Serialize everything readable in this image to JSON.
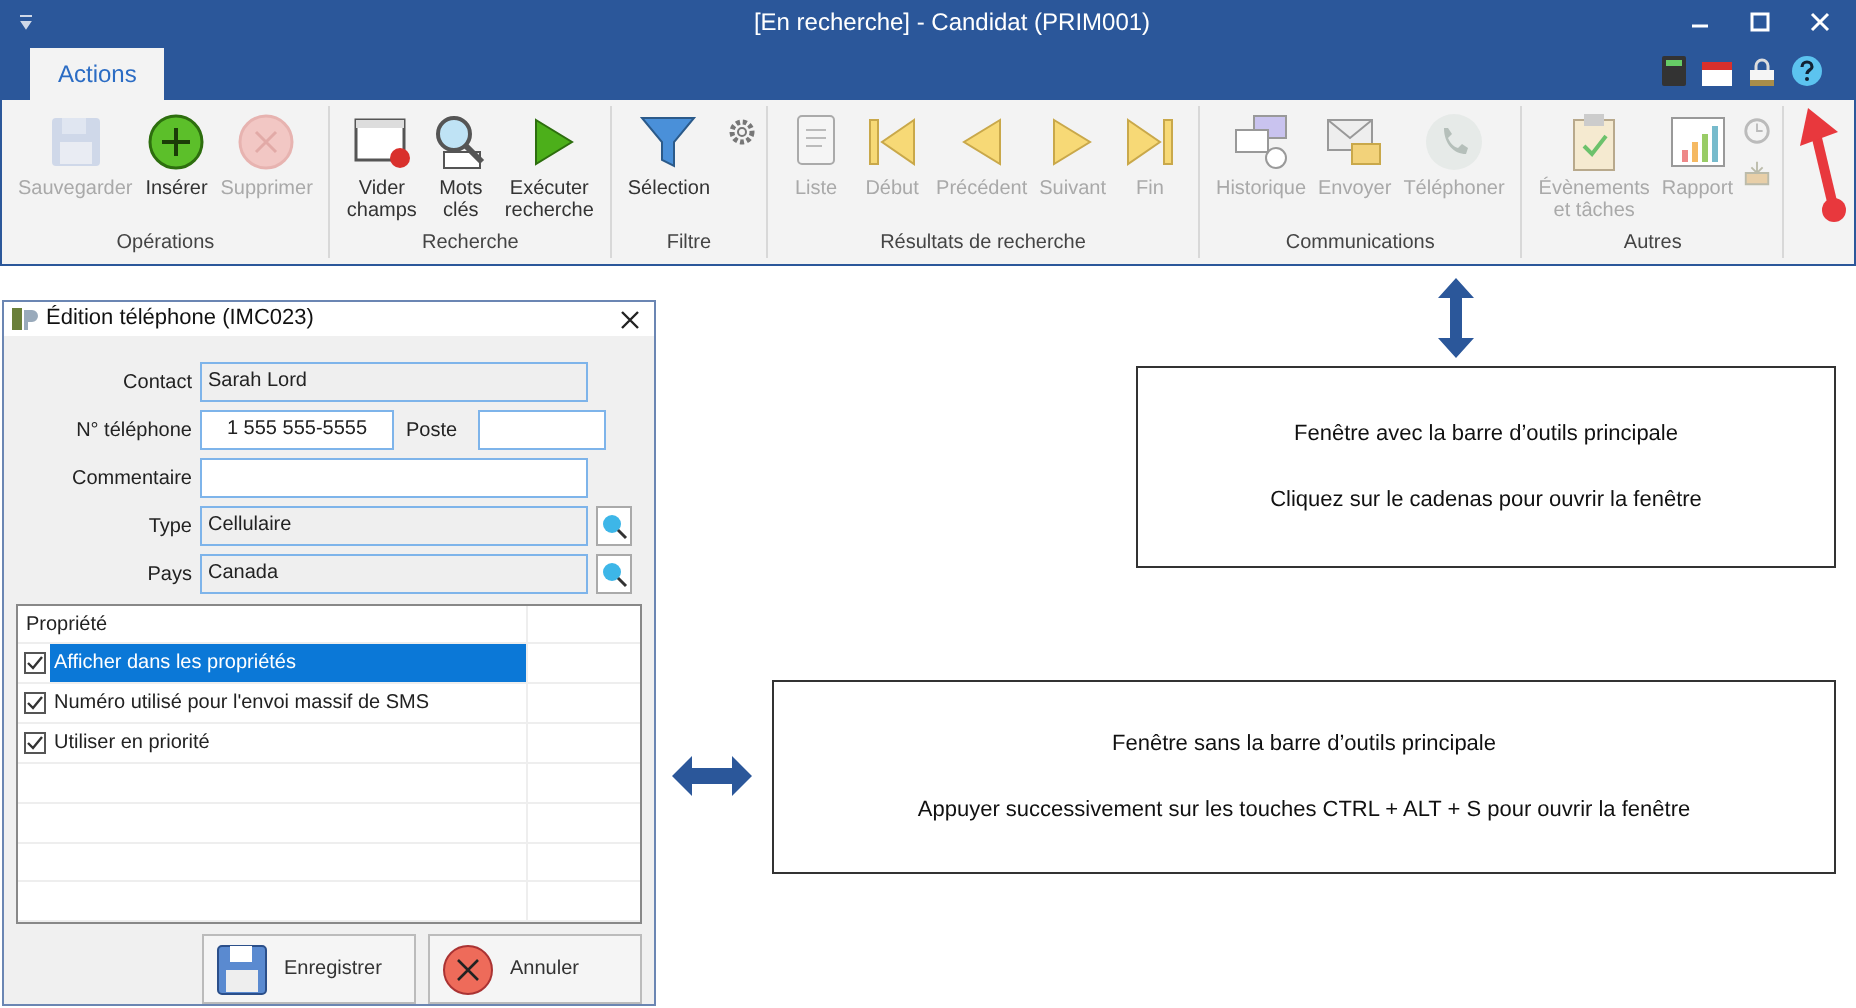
{
  "window": {
    "title": "[En recherche] - Candidat (PRIM001)"
  },
  "tabs": [
    {
      "label": "Actions",
      "selected": true
    }
  ],
  "ribbon_groups": [
    {
      "label": "Opérations",
      "buttons": [
        {
          "label": "Sauvegarder",
          "disabled": true
        },
        {
          "label": "Insérer",
          "disabled": false
        },
        {
          "label": "Supprimer",
          "disabled": true
        }
      ]
    },
    {
      "label": "Recherche",
      "buttons": [
        {
          "label": "Vider champs",
          "disabled": false
        },
        {
          "label": "Mots clés",
          "disabled": false
        },
        {
          "label": "Exécuter recherche",
          "disabled": false
        }
      ]
    },
    {
      "label": "Filtre",
      "buttons": [
        {
          "label": "Sélection",
          "disabled": false
        }
      ]
    },
    {
      "label": "Résultats de recherche",
      "buttons": [
        {
          "label": "Liste",
          "disabled": true
        },
        {
          "label": "Début",
          "disabled": true
        },
        {
          "label": "Précédent",
          "disabled": true
        },
        {
          "label": "Suivant",
          "disabled": true
        },
        {
          "label": "Fin",
          "disabled": true
        }
      ]
    },
    {
      "label": "Communications",
      "buttons": [
        {
          "label": "Historique",
          "disabled": true
        },
        {
          "label": "Envoyer",
          "disabled": true
        },
        {
          "label": "Téléphoner",
          "disabled": true
        }
      ]
    },
    {
      "label": "Autres",
      "buttons": [
        {
          "label": "Évènements et tâches",
          "disabled": true
        },
        {
          "label": "Rapport",
          "disabled": true
        }
      ]
    }
  ],
  "dialog": {
    "title": "Édition téléphone (IMC023)",
    "field_rows": [
      [
        {
          "label": "Contact",
          "value": "Sarah Lord",
          "readonly": true
        }
      ],
      [
        {
          "label": "N° téléphone",
          "value": "1 555 555-5555",
          "readonly": false
        },
        {
          "label": "Poste",
          "readonly": false
        }
      ],
      [
        {
          "label": "Commentaire",
          "readonly": false
        }
      ],
      [
        {
          "label": "Type",
          "value": "Cellulaire",
          "readonly": true,
          "lookup": true
        }
      ],
      [
        {
          "label": "Pays",
          "value": "Canada",
          "readonly": true,
          "lookup": true
        }
      ]
    ],
    "table": {
      "columns": [
        "Propriété"
      ],
      "rows": [
        {
          "label": "Afficher dans les propriétés",
          "checked": true,
          "selected": true
        },
        {
          "label": "Numéro utilisé pour l'envoi massif de SMS",
          "checked": true,
          "selected": false
        },
        {
          "label": "Utiliser en priorité",
          "checked": true,
          "selected": false
        }
      ]
    },
    "buttons": [
      "Enregistrer",
      "Annuler"
    ]
  },
  "notes": [
    {
      "lines": [
        "Fenêtre avec la barre d’outils principale",
        "Cliquez sur le cadenas pour ouvrir la fenêtre"
      ]
    },
    {
      "lines": [
        "Fenêtre sans la barre d’outils principale",
        "Appuyer successivement sur les touches CTRL + ALT + S pour ouvrir la fenêtre"
      ]
    }
  ]
}
